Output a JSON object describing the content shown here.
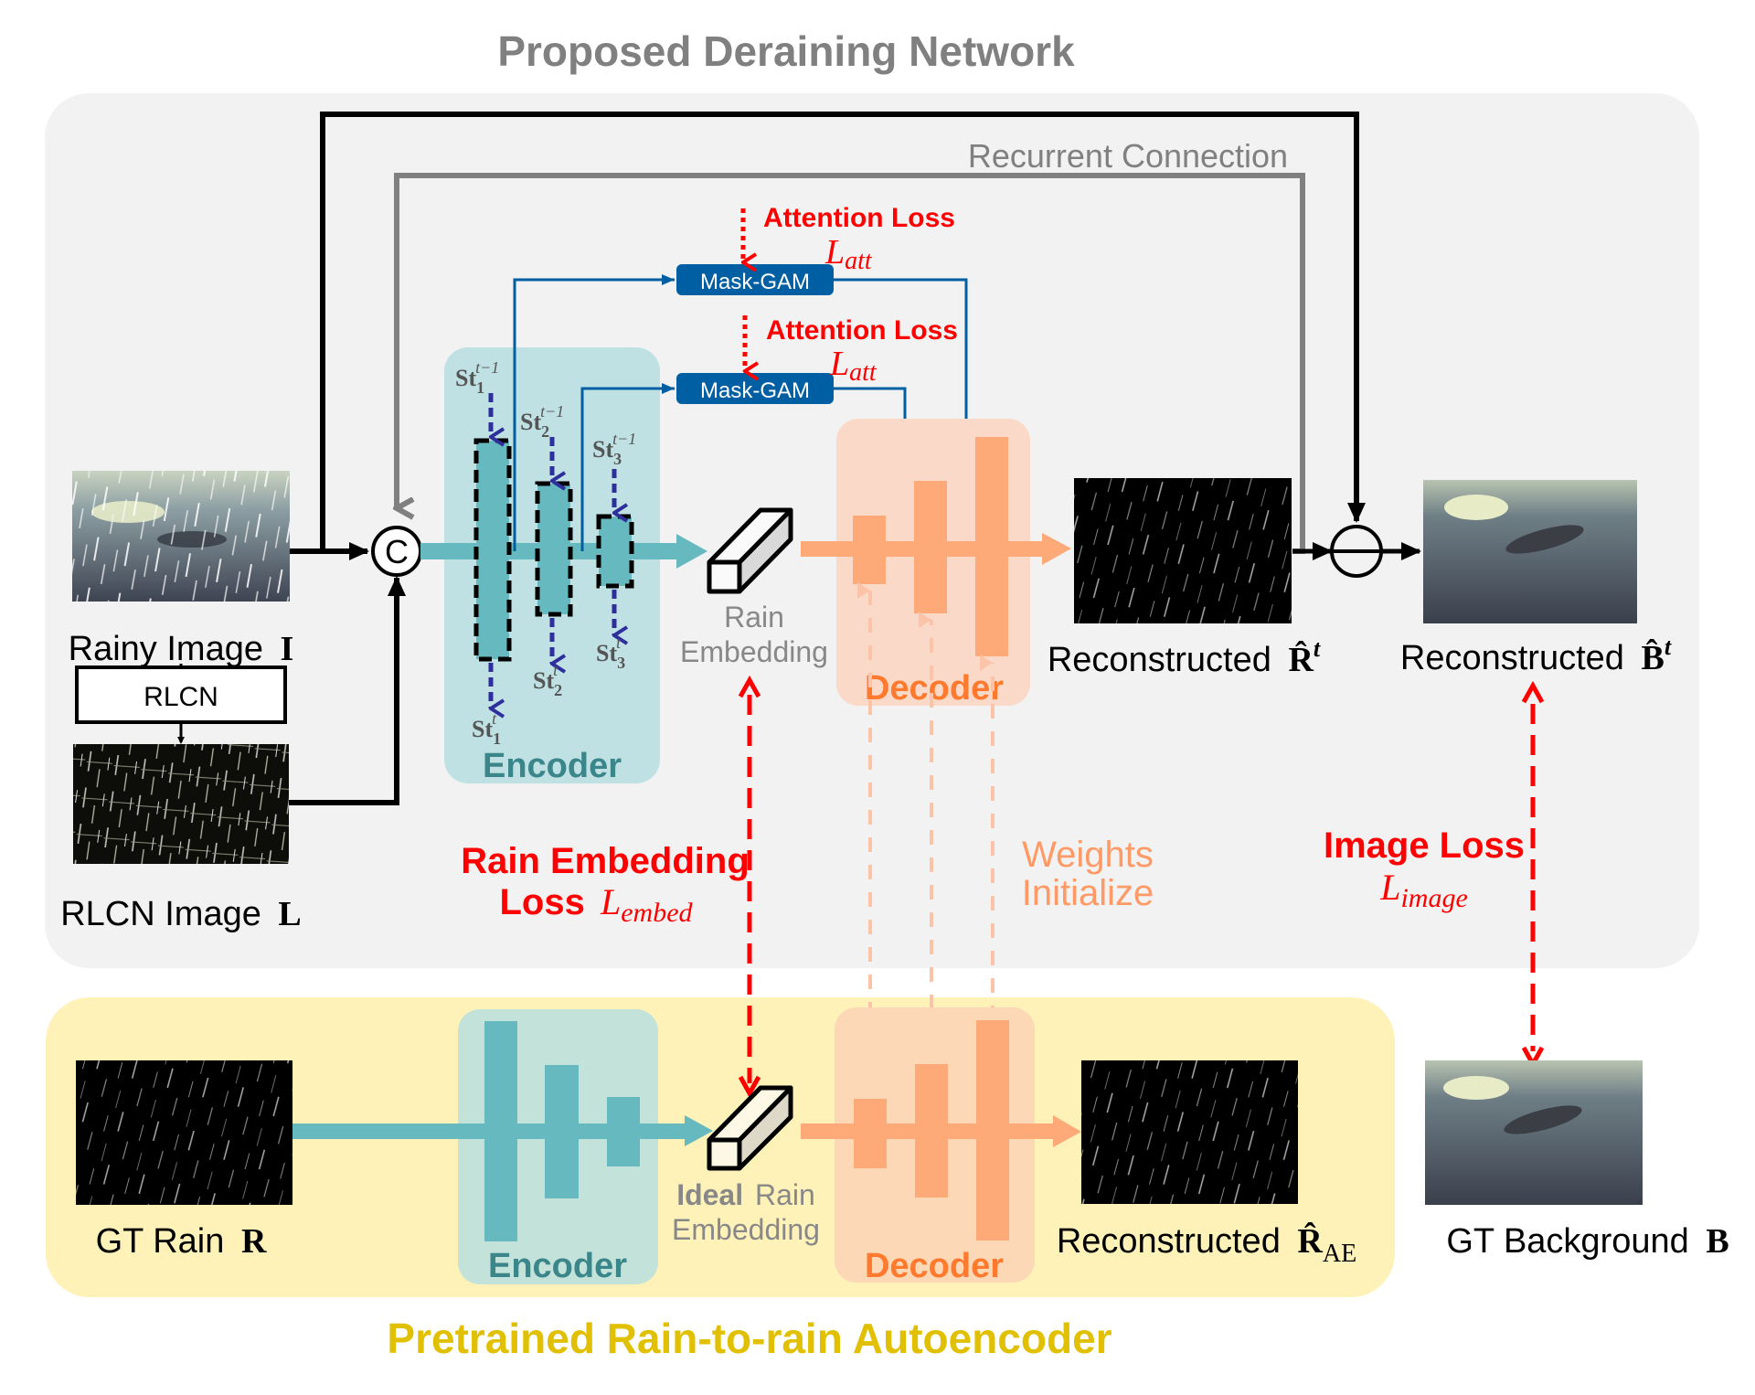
{
  "title": "Proposed Deraining Network",
  "bottom_title": "Pretrained Rain-to-rain Autoencoder",
  "colors": {
    "panel_gray": "#f2f2f2",
    "panel_yellow": "#fff2b8",
    "encoder_box": "#bfe1e3",
    "encoder_box_bottom": "#c3e2d9",
    "encoder_bar": "#67b9c0",
    "encoder_label": "#3a868b",
    "decoder_box": "#fbd9c8",
    "decoder_box_bottom": "#fcd8b6",
    "decoder_bar": "#fda978",
    "decoder_label": "#ff7a2e",
    "mask_gam": "#005ea2",
    "loss_red": "#ff0000",
    "state_arrow": "#2e2e9c",
    "title_gray": "#808080",
    "title_yellow": "#e0c000",
    "weights_text": "#ff9a66"
  },
  "recurrent_label": "Recurrent Connection",
  "inputs": {
    "rainy_label": "Rainy Image",
    "rainy_symbol": "I",
    "rlcn_box": "RLCN",
    "rlcn_label": "RLCN Image",
    "rlcn_symbol": "L"
  },
  "concat_symbol": "C",
  "encoder": {
    "label": "Encoder",
    "states_prev": [
      {
        "base": "St",
        "sub": "1",
        "sup": "t−1"
      },
      {
        "base": "St",
        "sub": "2",
        "sup": "t−1"
      },
      {
        "base": "St",
        "sub": "3",
        "sup": "t−1"
      }
    ],
    "states_curr": [
      {
        "base": "St",
        "sub": "1",
        "sup": "t"
      },
      {
        "base": "St",
        "sub": "2",
        "sup": "t"
      },
      {
        "base": "St",
        "sub": "3",
        "sup": "t"
      }
    ]
  },
  "mask_gam": [
    {
      "label": "Mask-GAM",
      "loss_text": "Attention Loss",
      "loss_symbol": "L",
      "loss_sub": "att"
    },
    {
      "label": "Mask-GAM",
      "loss_text": "Attention Loss",
      "loss_symbol": "L",
      "loss_sub": "att"
    }
  ],
  "embedding": {
    "line1": "Rain",
    "line2": "Embedding"
  },
  "decoder": {
    "label": "Decoder"
  },
  "outputs": {
    "recon_r_label": "Reconstructed",
    "recon_r_symbol": "R̂",
    "recon_r_sup": "t",
    "recon_b_label": "Reconstructed",
    "recon_b_symbol": "B̂",
    "recon_b_sup": "t"
  },
  "losses": {
    "embed_line1": "Rain Embedding",
    "embed_line2": "Loss",
    "embed_symbol": "L",
    "embed_sub": "embed",
    "image_line1": "Image Loss",
    "image_symbol": "L",
    "image_sub": "image",
    "weights_line1": "Weights",
    "weights_line2": "Initialize"
  },
  "autoencoder": {
    "gt_rain_label": "GT Rain",
    "gt_rain_symbol": "R",
    "encoder_label": "Encoder",
    "ideal_bold": "Ideal",
    "ideal_rest": "Rain",
    "ideal_line2": "Embedding",
    "decoder_label": "Decoder",
    "recon_label": "Reconstructed",
    "recon_symbol": "R̂",
    "recon_sub": "AE"
  },
  "gt_background": {
    "label": "GT Background",
    "symbol": "B"
  }
}
